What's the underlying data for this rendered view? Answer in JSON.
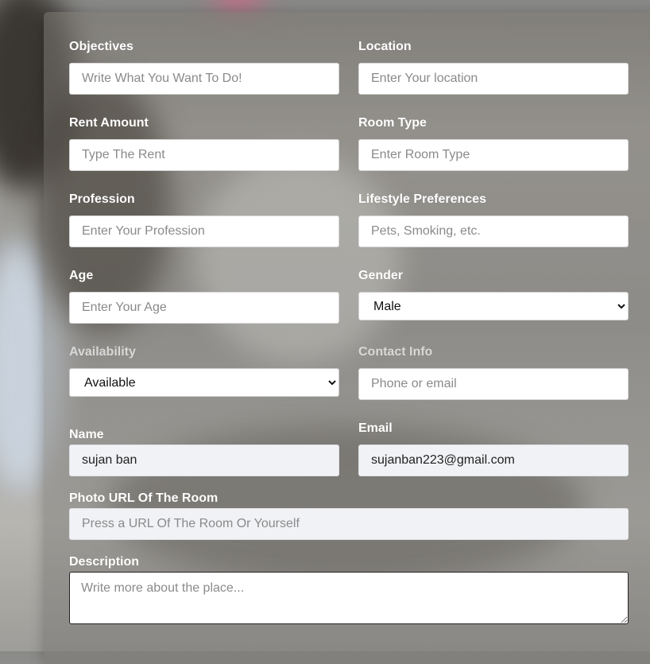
{
  "form": {
    "objectives": {
      "label": "Objectives",
      "placeholder": "Write What You Want To Do!"
    },
    "location": {
      "label": "Location",
      "placeholder": "Enter Your location"
    },
    "rent_amount": {
      "label": "Rent Amount",
      "placeholder": "Type The Rent"
    },
    "room_type": {
      "label": "Room Type",
      "placeholder": "Enter Room Type"
    },
    "profession": {
      "label": "Profession",
      "placeholder": "Enter Your Profession"
    },
    "lifestyle": {
      "label": "Lifestyle Preferences",
      "placeholder": "Pets, Smoking, etc."
    },
    "age": {
      "label": "Age",
      "placeholder": "Enter Your Age"
    },
    "gender": {
      "label": "Gender",
      "selected": "Male"
    },
    "availability": {
      "label": "Availability",
      "selected": "Available"
    },
    "contact": {
      "label": "Contact Info",
      "placeholder": "Phone or email"
    },
    "name": {
      "label": "Name",
      "value": "sujan ban"
    },
    "email": {
      "label": "Email",
      "value": "sujanban223@gmail.com"
    },
    "photo_url": {
      "label": "Photo URL Of The Room",
      "placeholder": "Press a URL Of The Room Or Yourself"
    },
    "description": {
      "label": "Description",
      "placeholder": "Write more about the place..."
    }
  }
}
